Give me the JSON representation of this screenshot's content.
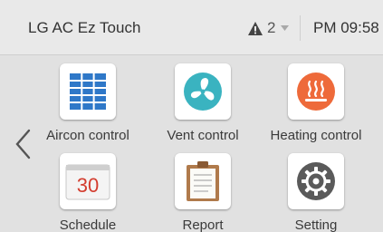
{
  "header": {
    "title": "LG AC Ez Touch",
    "alert_count": "2",
    "clock": "PM 09:58",
    "warning_icon": "warning-triangle-icon",
    "dropdown_icon": "chevron-down-icon"
  },
  "nav": {
    "prev_icon": "chevron-left-icon"
  },
  "menu": {
    "items": [
      {
        "label": "Aircon control",
        "icon": "aircon-grid-icon"
      },
      {
        "label": "Vent control",
        "icon": "fan-icon"
      },
      {
        "label": "Heating control",
        "icon": "heating-icon"
      },
      {
        "label": "Schedule",
        "icon": "calendar-icon",
        "icon_text": "30"
      },
      {
        "label": "Report",
        "icon": "clipboard-icon"
      },
      {
        "label": "Setting",
        "icon": "gear-icon"
      }
    ]
  },
  "colors": {
    "aircon_blue": "#2f78c8",
    "vent_teal": "#3ab3c0",
    "heating_orange": "#ee6a3a",
    "gear_gray": "#5a5a5a",
    "calendar_red": "#d33d2f"
  }
}
